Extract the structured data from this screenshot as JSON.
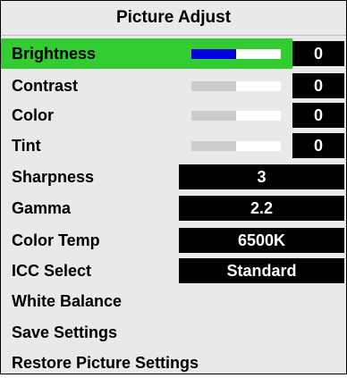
{
  "menu": {
    "title": "Picture Adjust",
    "colors": {
      "selected_highlight": "#33cc33",
      "active_slider_fill": "#0000dd"
    },
    "items": [
      {
        "label": "Brightness",
        "value": "0",
        "level": 0.5
      },
      {
        "label": "Contrast",
        "value": "0",
        "level": 0.5
      },
      {
        "label": "Color",
        "value": "0",
        "level": 0.5
      },
      {
        "label": "Tint",
        "value": "0",
        "level": 0.5
      },
      {
        "label": "Sharpness",
        "value": "3"
      },
      {
        "label": "Gamma",
        "value": "2.2"
      },
      {
        "label": "Color Temp",
        "value": "6500K"
      },
      {
        "label": "ICC Select",
        "value": "Standard"
      },
      {
        "label": "White Balance"
      },
      {
        "label": "Save Settings"
      },
      {
        "label": "Restore Picture Settings"
      }
    ]
  }
}
